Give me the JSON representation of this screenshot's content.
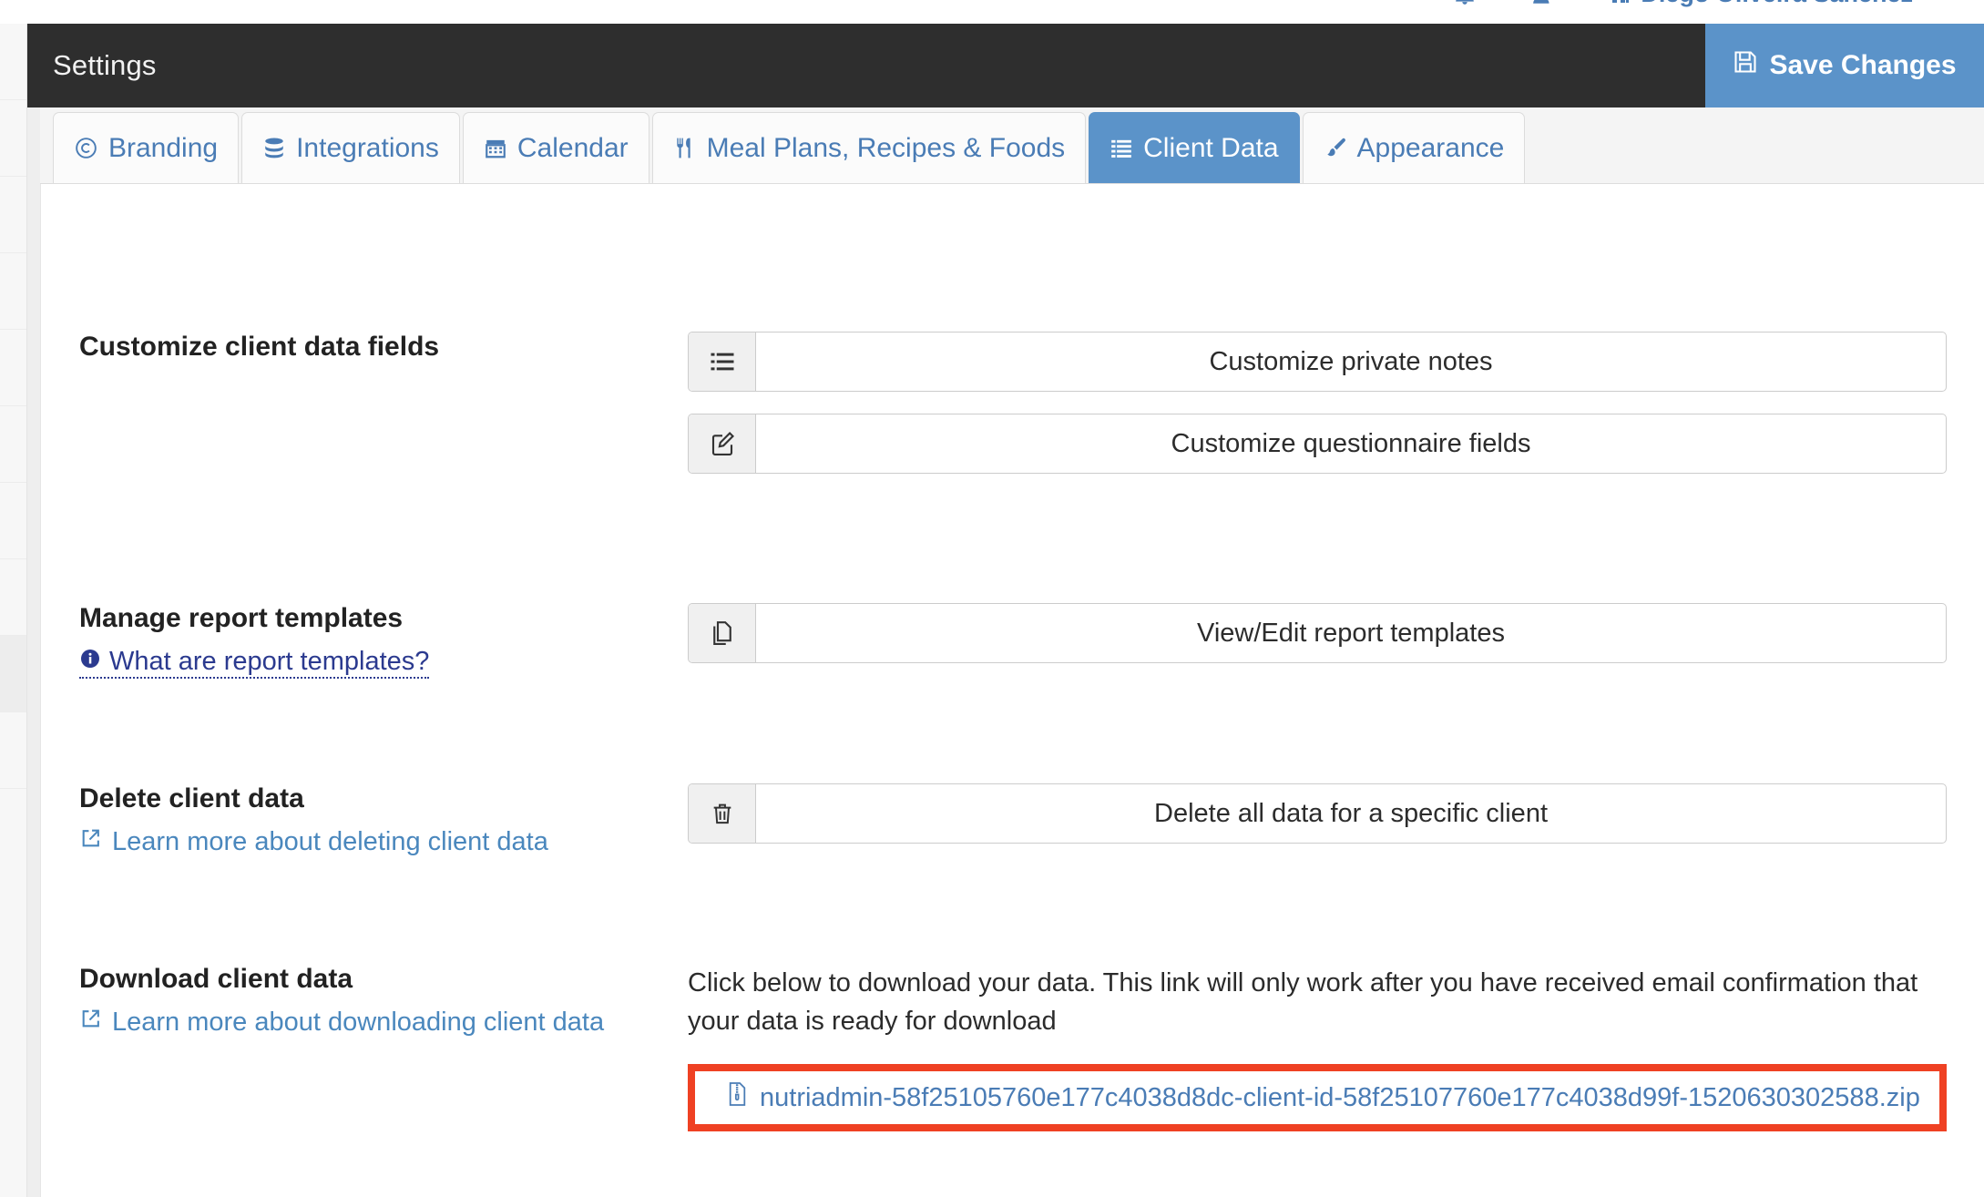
{
  "top_header": {
    "user_name": "Diego Oliveira Sanchez",
    "icons": [
      "bell-icon",
      "user-add-icon",
      "building-icon"
    ]
  },
  "page_header": {
    "title": "Settings",
    "save_label": "Save Changes",
    "save_icon": "floppy-save-icon",
    "background": "#2e2e2e",
    "accent": "#5b93c9"
  },
  "tabs": [
    {
      "label": "Branding",
      "icon": "copyright-icon",
      "active": false
    },
    {
      "label": "Integrations",
      "icon": "database-icon",
      "active": false
    },
    {
      "label": "Calendar",
      "icon": "calendar-icon",
      "active": false
    },
    {
      "label": "Meal Plans, Recipes & Foods",
      "icon": "cutlery-icon",
      "active": false
    },
    {
      "label": "Client Data",
      "icon": "list-icon",
      "active": true
    },
    {
      "label": "Appearance",
      "icon": "paintbrush-icon",
      "active": false
    }
  ],
  "sections": {
    "customize": {
      "title": "Customize client data fields",
      "buttons": [
        {
          "label": "Customize private notes",
          "icon": "list-ul-icon"
        },
        {
          "label": "Customize questionnaire fields",
          "icon": "edit-pencil-icon"
        }
      ]
    },
    "templates": {
      "title": "Manage report templates",
      "help_link": "What are report templates?",
      "help_icon": "info-circle-icon",
      "buttons": [
        {
          "label": "View/Edit report templates",
          "icon": "copy-files-icon"
        }
      ]
    },
    "delete": {
      "title": "Delete client data",
      "help_link": "Learn more about deleting client data",
      "help_icon": "external-link-icon",
      "buttons": [
        {
          "label": "Delete all data for a specific client",
          "icon": "trash-icon"
        }
      ]
    },
    "download": {
      "title": "Download client data",
      "help_link": "Learn more about downloading client data",
      "help_icon": "external-link-icon",
      "description": "Click below to download your data. This link will only work after you have received email confirmation that your data is ready for download",
      "file_icon": "file-archive-icon",
      "file_name": "nutriadmin-58f25105760e177c4038d8dc-client-id-58f25107760e177c4038d99f-1520630302588.zip",
      "highlight_color": "#ef4123"
    }
  }
}
